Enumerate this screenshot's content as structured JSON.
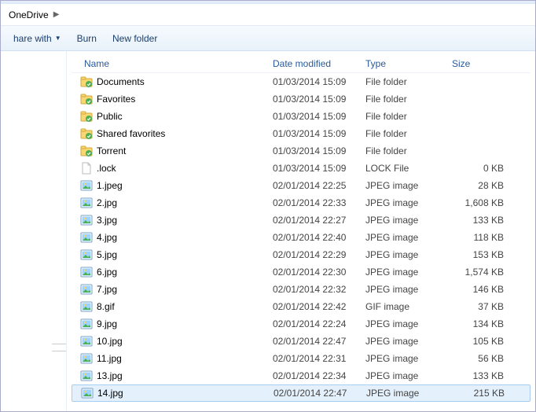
{
  "breadcrumb": {
    "segments": [
      "OneDrive"
    ]
  },
  "toolbar": {
    "share_label": "hare with",
    "burn_label": "Burn",
    "newfolder_label": "New folder"
  },
  "columns": {
    "name": "Name",
    "date": "Date modified",
    "type": "Type",
    "size": "Size"
  },
  "files": [
    {
      "icon": "folder-sync",
      "name": "Documents",
      "date": "01/03/2014 15:09",
      "type": "File folder",
      "size": ""
    },
    {
      "icon": "folder-sync",
      "name": "Favorites",
      "date": "01/03/2014 15:09",
      "type": "File folder",
      "size": ""
    },
    {
      "icon": "folder-sync",
      "name": "Public",
      "date": "01/03/2014 15:09",
      "type": "File folder",
      "size": ""
    },
    {
      "icon": "folder-sync",
      "name": "Shared favorites",
      "date": "01/03/2014 15:09",
      "type": "File folder",
      "size": ""
    },
    {
      "icon": "folder-sync",
      "name": "Torrent",
      "date": "01/03/2014 15:09",
      "type": "File folder",
      "size": ""
    },
    {
      "icon": "file",
      "name": ".lock",
      "date": "01/03/2014 15:09",
      "type": "LOCK File",
      "size": "0 KB"
    },
    {
      "icon": "image",
      "name": "1.jpeg",
      "date": "02/01/2014 22:25",
      "type": "JPEG image",
      "size": "28 KB"
    },
    {
      "icon": "image",
      "name": "2.jpg",
      "date": "02/01/2014 22:33",
      "type": "JPEG image",
      "size": "1,608 KB"
    },
    {
      "icon": "image",
      "name": "3.jpg",
      "date": "02/01/2014 22:27",
      "type": "JPEG image",
      "size": "133 KB"
    },
    {
      "icon": "image",
      "name": "4.jpg",
      "date": "02/01/2014 22:40",
      "type": "JPEG image",
      "size": "118 KB"
    },
    {
      "icon": "image",
      "name": "5.jpg",
      "date": "02/01/2014 22:29",
      "type": "JPEG image",
      "size": "153 KB"
    },
    {
      "icon": "image",
      "name": "6.jpg",
      "date": "02/01/2014 22:30",
      "type": "JPEG image",
      "size": "1,574 KB"
    },
    {
      "icon": "image",
      "name": "7.jpg",
      "date": "02/01/2014 22:32",
      "type": "JPEG image",
      "size": "146 KB"
    },
    {
      "icon": "image",
      "name": "8.gif",
      "date": "02/01/2014 22:42",
      "type": "GIF image",
      "size": "37 KB"
    },
    {
      "icon": "image",
      "name": "9.jpg",
      "date": "02/01/2014 22:24",
      "type": "JPEG image",
      "size": "134 KB"
    },
    {
      "icon": "image",
      "name": "10.jpg",
      "date": "02/01/2014 22:47",
      "type": "JPEG image",
      "size": "105 KB"
    },
    {
      "icon": "image",
      "name": "11.jpg",
      "date": "02/01/2014 22:31",
      "type": "JPEG image",
      "size": "56 KB"
    },
    {
      "icon": "image",
      "name": "13.jpg",
      "date": "02/01/2014 22:34",
      "type": "JPEG image",
      "size": "133 KB"
    },
    {
      "icon": "image",
      "name": "14.jpg",
      "date": "02/01/2014 22:47",
      "type": "JPEG image",
      "size": "215 KB",
      "selected": true
    }
  ]
}
